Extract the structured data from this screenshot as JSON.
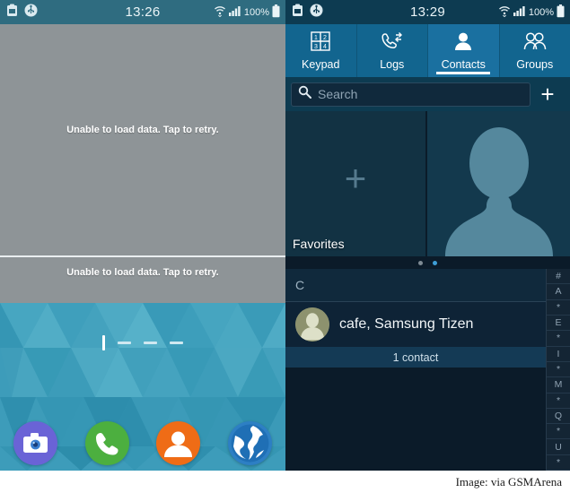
{
  "caption": {
    "text": "Image: via GSMArena"
  },
  "left_phone": {
    "status_bar": {
      "time": "13:26",
      "battery_percent": "100%",
      "icons": [
        "clipboard-icon",
        "usb-icon",
        "wifi-icon",
        "signal-icon",
        "battery-icon"
      ]
    },
    "widgets": [
      {
        "message": "Unable to load data. Tap to retry."
      },
      {
        "message": "Unable to load data. Tap to retry."
      }
    ],
    "page_indicator": {
      "active_index": 0,
      "total": 4
    },
    "dock": [
      {
        "name": "camera",
        "label": "Camera",
        "color": "#6a63d6"
      },
      {
        "name": "phone",
        "label": "Phone",
        "color": "#4caf3f"
      },
      {
        "name": "contacts",
        "label": "Contacts",
        "color": "#ef6c16"
      },
      {
        "name": "browser",
        "label": "Internet",
        "color": "#2d7fc4"
      }
    ]
  },
  "right_phone": {
    "status_bar": {
      "time": "13:29",
      "battery_percent": "100%",
      "icons": [
        "clipboard-icon",
        "usb-icon",
        "wifi-icon",
        "signal-icon",
        "battery-icon"
      ]
    },
    "tabs": [
      {
        "label": "Keypad",
        "icon": "keypad-icon",
        "active": false
      },
      {
        "label": "Logs",
        "icon": "call-logs-icon",
        "active": false
      },
      {
        "label": "Contacts",
        "icon": "person-icon",
        "active": true
      },
      {
        "label": "Groups",
        "icon": "group-icon",
        "active": false
      }
    ],
    "search": {
      "placeholder": "Search",
      "icon": "search-icon"
    },
    "add_button": {
      "label": "+"
    },
    "favorites": {
      "label": "Favorites",
      "add_icon": "plus-icon"
    },
    "page_dots": {
      "count": 2,
      "active_index": 1
    },
    "section_header": "C",
    "contacts": [
      {
        "name": "cafe, Samsung Tizen"
      }
    ],
    "count_text": "1 contact",
    "index_letters": [
      "#",
      "A",
      "*",
      "E",
      "*",
      "I",
      "*",
      "M",
      "*",
      "Q",
      "*",
      "U",
      "*"
    ]
  },
  "colors": {
    "left_statusbar": "#2f6c80",
    "right_statusbar": "#0d3b51",
    "tab_bar": "#12658f",
    "tab_active": "#1a70a0",
    "widget_gray": "#8e9497",
    "wallpaper": "#3d9cba",
    "accent_dot": "#3e9ed6"
  }
}
